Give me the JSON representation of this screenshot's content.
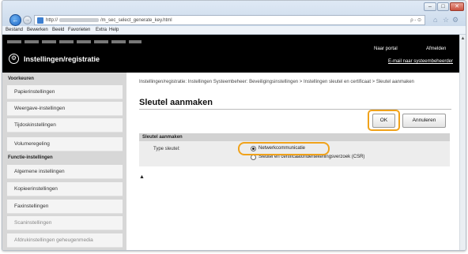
{
  "browser": {
    "url_prefix": "http://",
    "url_suffix": "/m_sec_select_generate_key.html",
    "url_tools": "ρ - ⊙",
    "window_controls": {
      "minimize": "–",
      "maximize": "□",
      "close": "✕"
    },
    "tab_icons": [
      "⌂",
      "☆",
      "⚙"
    ]
  },
  "menubar": {
    "items": [
      "Bestand",
      "Bewerken",
      "Beeld",
      "Favorieten",
      "Extra",
      "Help"
    ]
  },
  "header": {
    "title": "Instellingen/registratie",
    "portal_link": "Naar portal",
    "logout_link": "Afmelden",
    "email_link": "E-mail naar systeembeheerder"
  },
  "sidebar": {
    "heading_preferences": "Voorkeuren",
    "heading_functions": "Functie-instellingen",
    "preferences": [
      "Papierinstellingen",
      "Weergave-instellingen",
      "Tijdoskinstellingen",
      "Volumeregeling"
    ],
    "functions": [
      "Algemene instellingen",
      "Kopieerinstellingen",
      "Faxinstellingen",
      "Scaninstellingen",
      "Afdrukinstellingen geheugenmedia"
    ]
  },
  "main": {
    "breadcrumb": "Instellingen/registratie: Instellingen Systeembeheer: Beveiligingsinstellingen > Instellingen sleutel en certificaat > Sleutel aanmaken",
    "page_title": "Sleutel aanmaken",
    "ok_label": "OK",
    "cancel_label": "Annuleren",
    "section_title": "Sleutel aanmaken",
    "key_type_label": "Type sleutel:",
    "options": [
      {
        "label": "Netwerkcommunicatie",
        "selected": true
      },
      {
        "label": "Sleutel en certificaatondertekeningsverzoek (CSR)",
        "selected": false
      }
    ],
    "top_link_icon": "▲"
  },
  "colors": {
    "highlight": "#f0a21a",
    "header_bg": "#000000",
    "sidebar_bg": "#d7d7d7"
  }
}
